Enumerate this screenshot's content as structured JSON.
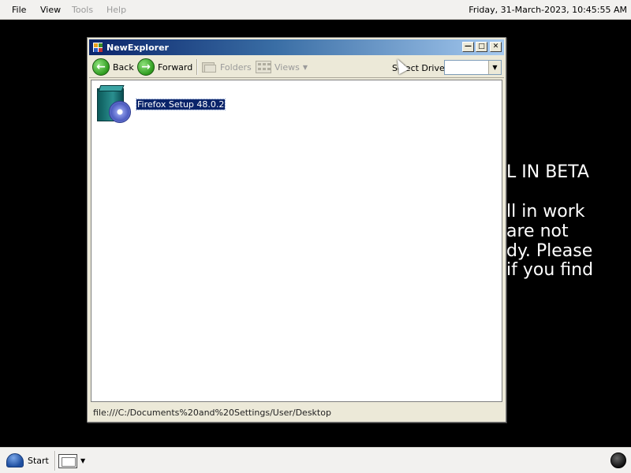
{
  "menubar": {
    "file": "File",
    "view": "View",
    "tools": "Tools",
    "help": "Help",
    "clock": "Friday, 31-March-2023, 10:45:55 AM"
  },
  "desktop": {
    "background_text_lines": [
      "L IN BETA",
      "ll in work",
      "are not",
      "dy. Please",
      " if you find"
    ]
  },
  "window": {
    "title": "NewExplorer",
    "toolbar": {
      "back_label": "Back",
      "forward_label": "Forward",
      "folders_label": "Folders",
      "views_label": "Views",
      "drive_label": "Select Drive:",
      "drive_value": ""
    },
    "files": [
      {
        "name": "Firefox Setup 48.0.2",
        "icon": "installer-package-icon",
        "selected": true
      }
    ],
    "status_path": "file:///C:/Documents%20and%20Settings/User/Desktop"
  },
  "taskbar": {
    "start_label": "Start"
  },
  "colors": {
    "titlebar_start": "#0a246a",
    "titlebar_end": "#a6caf0",
    "selection": "#0a246a",
    "window_face": "#ece9d8"
  }
}
